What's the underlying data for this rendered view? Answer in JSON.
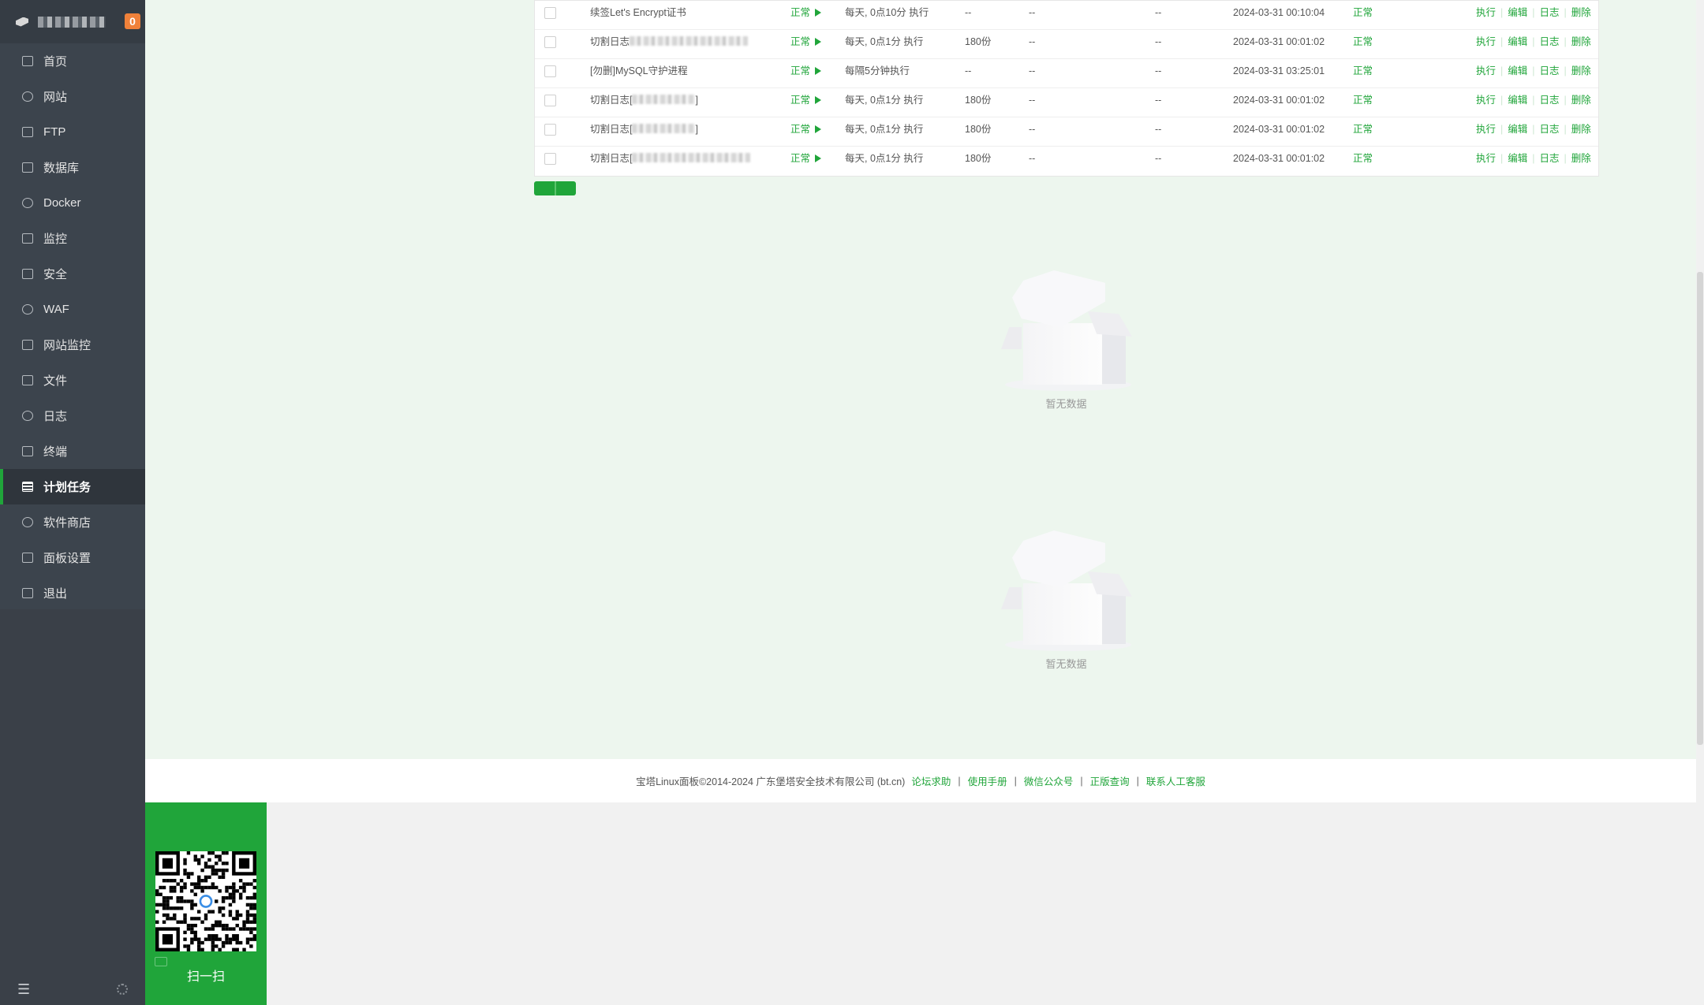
{
  "sidebar": {
    "badge": "0",
    "menu": [
      {
        "label": "首页",
        "icon": "home-icon",
        "active": false
      },
      {
        "label": "网站",
        "icon": "globe-icon",
        "active": false
      },
      {
        "label": "FTP",
        "icon": "ftp-icon",
        "active": false
      },
      {
        "label": "数据库",
        "icon": "database-icon",
        "active": false
      },
      {
        "label": "Docker",
        "icon": "docker-icon",
        "active": false
      },
      {
        "label": "监控",
        "icon": "monitor-icon",
        "active": false
      },
      {
        "label": "安全",
        "icon": "shield-icon",
        "active": false
      },
      {
        "label": "WAF",
        "icon": "waf-icon",
        "active": false
      },
      {
        "label": "网站监控",
        "icon": "chart-icon",
        "active": false
      },
      {
        "label": "文件",
        "icon": "folder-icon",
        "active": false
      },
      {
        "label": "日志",
        "icon": "log-icon",
        "active": false
      },
      {
        "label": "终端",
        "icon": "terminal-icon",
        "active": false
      },
      {
        "label": "计划任务",
        "icon": "calendar-icon",
        "active": true
      },
      {
        "label": "软件商店",
        "icon": "grid-icon",
        "active": false
      },
      {
        "label": "面板设置",
        "icon": "gear-icon",
        "active": false
      },
      {
        "label": "退出",
        "icon": "logout-icon",
        "active": false
      }
    ]
  },
  "tasks": [
    {
      "name": "续签Let's Encrypt证书",
      "blurred": false,
      "status": "正常",
      "cycle": "每天, 0点10分 执行",
      "save": "--",
      "backup_to": "--",
      "backup": "--",
      "last_run": "2024-03-31 00:10:04",
      "result": "正常"
    },
    {
      "name": "切割日志",
      "blurred": true,
      "blur_suffix": "",
      "status": "正常",
      "cycle": "每天, 0点1分 执行",
      "save": "180份",
      "backup_to": "--",
      "backup": "--",
      "last_run": "2024-03-31 00:01:02",
      "result": "正常"
    },
    {
      "name": "[勿删]MySQL守护进程",
      "blurred": false,
      "status": "正常",
      "cycle": "每隔5分钟执行",
      "save": "--",
      "backup_to": "--",
      "backup": "--",
      "last_run": "2024-03-31 03:25:01",
      "result": "正常"
    },
    {
      "name": "切割日志[",
      "blurred": true,
      "blur_suffix": "]",
      "status": "正常",
      "cycle": "每天, 0点1分 执行",
      "save": "180份",
      "backup_to": "--",
      "backup": "--",
      "last_run": "2024-03-31 00:01:02",
      "result": "正常"
    },
    {
      "name": "切割日志[",
      "blurred": true,
      "blur_suffix": "]",
      "status": "正常",
      "cycle": "每天, 0点1分 执行",
      "save": "180份",
      "backup_to": "--",
      "backup": "--",
      "last_run": "2024-03-31 00:01:02",
      "result": "正常"
    },
    {
      "name": "切割日志[",
      "blurred": true,
      "blur_suffix": "",
      "status": "正常",
      "cycle": "每天, 0点1分 执行",
      "save": "180份",
      "backup_to": "--",
      "backup": "--",
      "last_run": "2024-03-31 00:01:02",
      "result": "正常"
    }
  ],
  "ops": {
    "run": "执行",
    "edit": "编辑",
    "log": "日志",
    "delete": "删除"
  },
  "empty_text": "暂无数据",
  "footer": {
    "copyright": "宝塔Linux面板©2014-2024 广东堡塔安全技术有限公司 (bt.cn)",
    "links": [
      "论坛求助",
      "使用手册",
      "微信公众号",
      "正版查询",
      "联系人工客服"
    ]
  },
  "qr": {
    "label": "扫一扫"
  },
  "colors": {
    "accent": "#20a53a",
    "sidebar": "#3c444d",
    "main_bg": "#edf6ee"
  }
}
